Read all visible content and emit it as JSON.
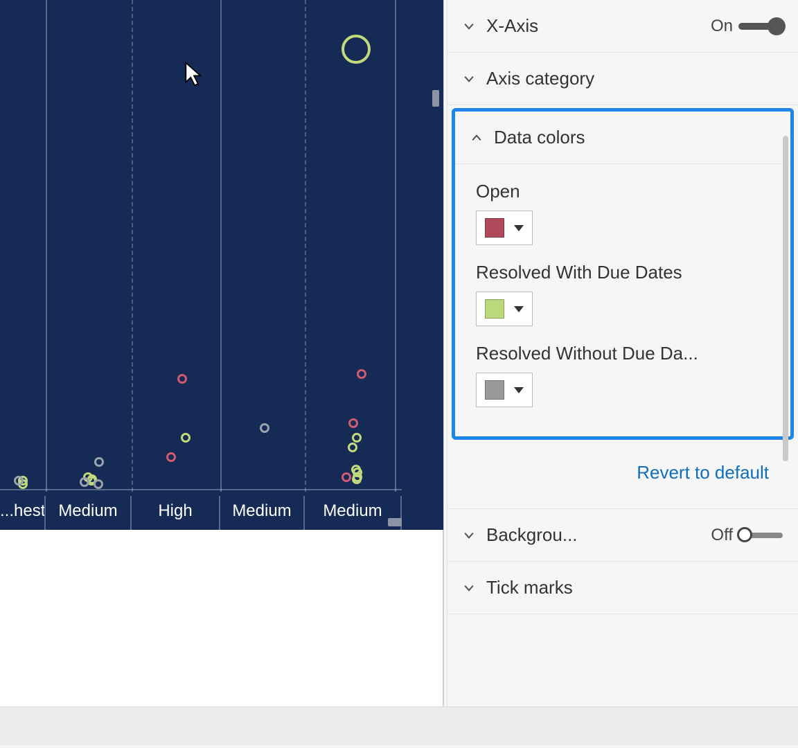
{
  "panel": {
    "xaxis": {
      "label": "X-Axis",
      "state": "On"
    },
    "axis_category": {
      "label": "Axis category"
    },
    "data_colors": {
      "label": "Data colors",
      "items": [
        {
          "label": "Open",
          "color": "#b04a5a"
        },
        {
          "label": "Resolved With Due Dates",
          "color": "#b9d97b"
        },
        {
          "label": "Resolved Without Due Da...",
          "color": "#9a9a9a"
        }
      ],
      "revert": "Revert to default"
    },
    "background": {
      "label": "Backgrou...",
      "state": "Off"
    },
    "tick_marks": {
      "label": "Tick marks"
    }
  },
  "chart_data": {
    "type": "scatter",
    "xlabel": "",
    "ylabel": "",
    "categories_visible": [
      "...hest",
      "Medium",
      "High",
      "Medium",
      "Medium"
    ],
    "series": [
      {
        "name": "Open",
        "color": "#cf5a72",
        "points": [
          {
            "cat": 2,
            "y": 0.77
          },
          {
            "cat": 2,
            "y": 0.93
          },
          {
            "cat": 4,
            "y": 0.76
          },
          {
            "cat": 4,
            "y": 0.86
          },
          {
            "cat": 4,
            "y": 0.97
          }
        ]
      },
      {
        "name": "Resolved With Due Dates",
        "color": "#c2da7c",
        "points": [
          {
            "cat": 4,
            "y": 0.1,
            "size": "large"
          },
          {
            "cat": 2,
            "y": 0.89
          },
          {
            "cat": 4,
            "y": 0.89
          },
          {
            "cat": 4,
            "y": 0.91
          },
          {
            "cat": 4,
            "y": 0.96
          },
          {
            "cat": 4,
            "y": 0.955
          },
          {
            "cat": 4,
            "y": 0.97
          },
          {
            "cat": 4,
            "y": 0.975
          },
          {
            "cat": 1,
            "y": 0.97
          },
          {
            "cat": 1,
            "y": 0.975
          },
          {
            "cat": 1,
            "y": 0.978
          },
          {
            "cat": 0,
            "y": 0.978
          },
          {
            "cat": 0,
            "y": 0.985
          }
        ]
      },
      {
        "name": "Resolved Without Due Dates",
        "color": "#9aa2ae",
        "points": [
          {
            "cat": 3,
            "y": 0.87
          },
          {
            "cat": 1,
            "y": 0.94
          },
          {
            "cat": 1,
            "y": 0.98
          },
          {
            "cat": 1,
            "y": 0.985
          },
          {
            "cat": 0,
            "y": 0.978
          }
        ]
      }
    ]
  }
}
